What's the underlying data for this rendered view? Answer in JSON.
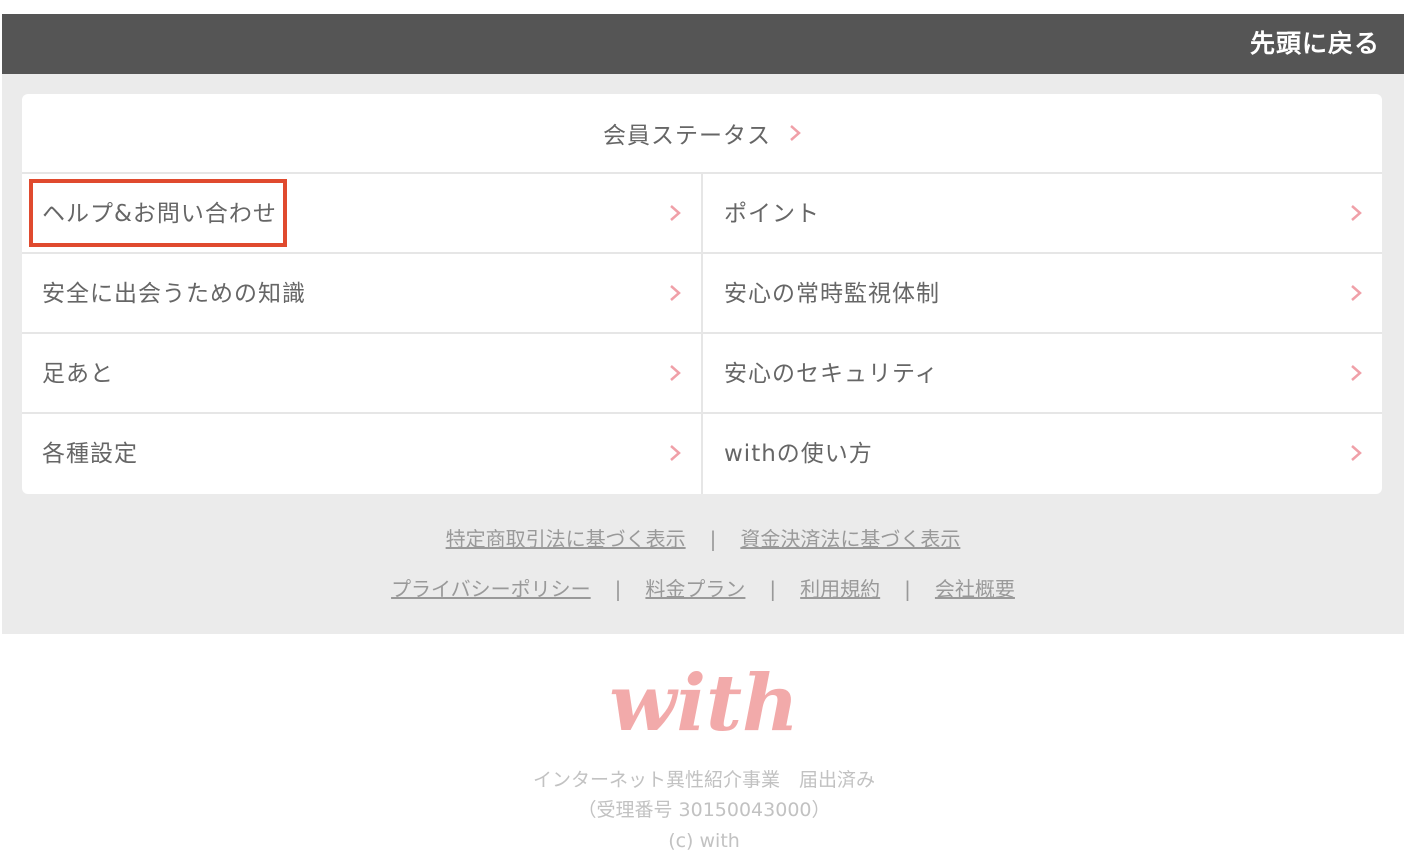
{
  "header": {
    "back_to_top": "先頭に戻る"
  },
  "menu": {
    "status": "会員ステータス",
    "rows": [
      {
        "left": "ヘルプ&お問い合わせ",
        "right": "ポイント"
      },
      {
        "left": "安全に出会うための知識",
        "right": "安心の常時監視体制"
      },
      {
        "left": "足あと",
        "right": "安心のセキュリティ"
      },
      {
        "left": "各種設定",
        "right": "withの使い方"
      }
    ]
  },
  "footer_links": {
    "line1": [
      "特定商取引法に基づく表示",
      "資金決済法に基づく表示"
    ],
    "line2": [
      "プライバシーポリシー",
      "料金プラン",
      "利用規約",
      "会社概要"
    ],
    "separator": "|"
  },
  "brand": {
    "logo_text": "with",
    "registration": "インターネット異性紹介事業　届出済み",
    "registration_number": "（受理番号 30150043000）",
    "copyright": "(c) with"
  },
  "colors": {
    "header_bg": "#555555",
    "accent_pink": "#f0a0a8",
    "highlight_red": "#e04a2e"
  },
  "icons": {
    "chevron": "chevron-right-icon",
    "logo": "with-logo"
  }
}
